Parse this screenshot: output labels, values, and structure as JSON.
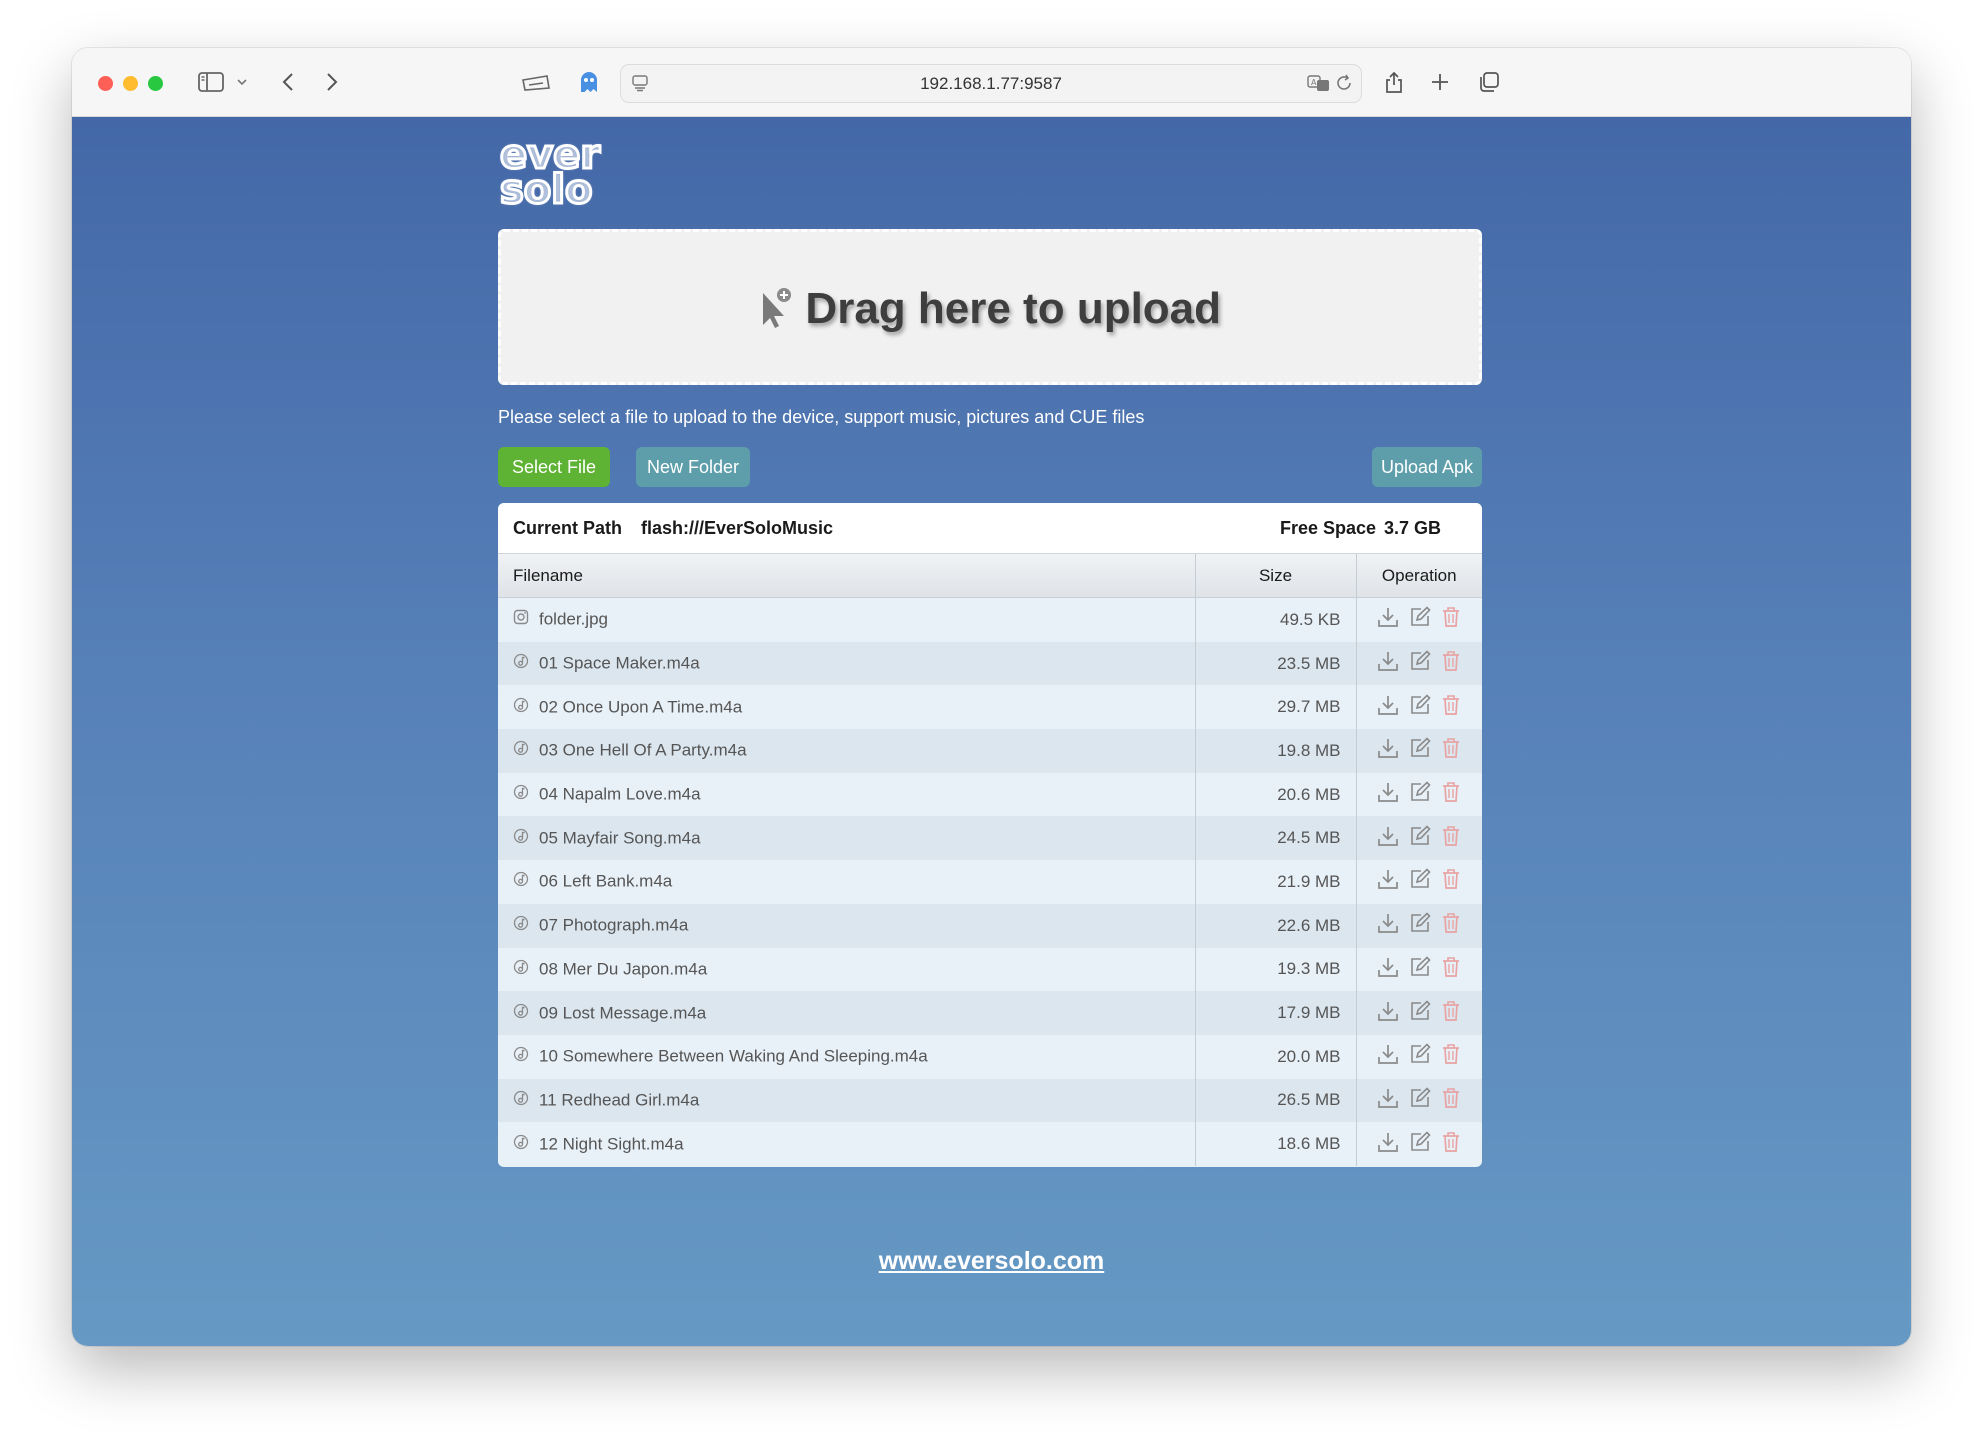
{
  "browser": {
    "url": "192.168.1.77:9587"
  },
  "logo": {
    "line1": "ever",
    "line2": "solo"
  },
  "dropzone": {
    "text": "Drag here to upload"
  },
  "help_text": "Please select a file to upload to the device, support music, pictures and CUE files",
  "buttons": {
    "select_file": "Select File",
    "new_folder": "New Folder",
    "upload_apk": "Upload Apk"
  },
  "path_bar": {
    "current_path_label": "Current Path",
    "current_path_value": "flash:///EverSoloMusic",
    "free_space_label": "Free Space",
    "free_space_value": "3.7 GB"
  },
  "table": {
    "headers": {
      "filename": "Filename",
      "size": "Size",
      "operation": "Operation"
    },
    "rows": [
      {
        "type": "image",
        "name": "folder.jpg",
        "size": "49.5 KB"
      },
      {
        "type": "music",
        "name": "01 Space Maker.m4a",
        "size": "23.5 MB"
      },
      {
        "type": "music",
        "name": "02 Once Upon A Time.m4a",
        "size": "29.7 MB"
      },
      {
        "type": "music",
        "name": "03 One Hell Of A Party.m4a",
        "size": "19.8 MB"
      },
      {
        "type": "music",
        "name": "04 Napalm Love.m4a",
        "size": "20.6 MB"
      },
      {
        "type": "music",
        "name": "05 Mayfair Song.m4a",
        "size": "24.5 MB"
      },
      {
        "type": "music",
        "name": "06 Left Bank.m4a",
        "size": "21.9 MB"
      },
      {
        "type": "music",
        "name": "07 Photograph.m4a",
        "size": "22.6 MB"
      },
      {
        "type": "music",
        "name": "08 Mer Du Japon.m4a",
        "size": "19.3 MB"
      },
      {
        "type": "music",
        "name": "09 Lost Message.m4a",
        "size": "17.9 MB"
      },
      {
        "type": "music",
        "name": "10 Somewhere Between Waking And Sleeping.m4a",
        "size": "20.0 MB"
      },
      {
        "type": "music",
        "name": "11 Redhead Girl.m4a",
        "size": "26.5 MB"
      },
      {
        "type": "music",
        "name": "12 Night Sight.m4a",
        "size": "18.6 MB"
      }
    ]
  },
  "footer": {
    "link": "www.eversolo.com"
  },
  "colors": {
    "select_button": "#5fb334",
    "secondary_button": "#5d9eaa",
    "delete_icon": "#e8a3a3",
    "gradient_top": "#4468a7",
    "gradient_bottom": "#6699c4"
  },
  "icons": {
    "row_image": "image-file-icon",
    "row_music": "music-file-icon",
    "download": "download-icon",
    "edit": "edit-icon",
    "delete": "trash-icon"
  }
}
